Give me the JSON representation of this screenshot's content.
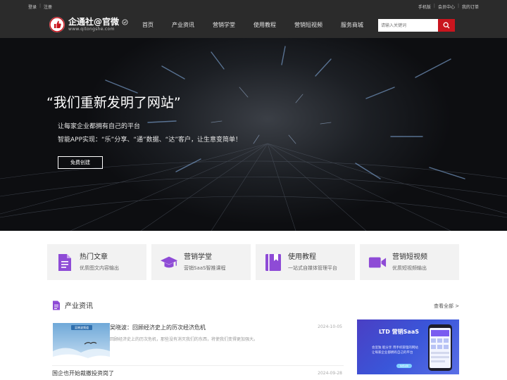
{
  "topbar": {
    "left": [
      "登录",
      "注册"
    ],
    "right": [
      "手机版",
      "会员中心",
      "我的订单"
    ]
  },
  "header": {
    "logo_title": "企通社@官微",
    "logo_sub": "www.qitongshe.com",
    "nav": [
      "首页",
      "产业资讯",
      "营销学堂",
      "使用教程",
      "营销短视频",
      "服务商城"
    ],
    "search_placeholder": "请输入关键词"
  },
  "hero": {
    "headline": "“我们重新发明了网站”",
    "line1": "让每家企业都拥有自己的平台",
    "line2": "智能APP实现：“乐”分享、“通”数据、“达”客户，让生意变简单！",
    "cta": "免费创建"
  },
  "features": [
    {
      "title": "热门文章",
      "desc": "优质图文内容输出",
      "icon": "document-icon"
    },
    {
      "title": "营销学堂",
      "desc": "营销SaaS智推课程",
      "icon": "graduation-cap-icon"
    },
    {
      "title": "使用教程",
      "desc": "一站式自媒体管理平台",
      "icon": "book-icon"
    },
    {
      "title": "营销短视频",
      "desc": "优质短视频输出",
      "icon": "video-camera-icon"
    }
  ],
  "news": {
    "section_title": "产业资讯",
    "view_all": "查看全部 >",
    "items": [
      {
        "title": "吴晓波：回顾经济史上的历次经济危机",
        "excerpt": "回顾经济史上的历次危机，那些没有消灭我们的东西，将使我们变得更加强大。",
        "date": "2024-10-05",
        "thumb_caption": "吴晓波频道"
      },
      {
        "title": "国企也开始裁撤投资岗了",
        "date": "2024-09-28"
      }
    ]
  },
  "ad": {
    "brand": "LTD 营销SaaS",
    "line1": "会宣独 能分享 用手机管理的网站",
    "line2": "让每家企业都拥有自己的平台",
    "button": "免费试用"
  },
  "colors": {
    "header_bg": "#2b2b2b",
    "search_button": "#c9151e",
    "feature_icon": "#8e4bd6",
    "ad_bg": "#3a56d9"
  }
}
